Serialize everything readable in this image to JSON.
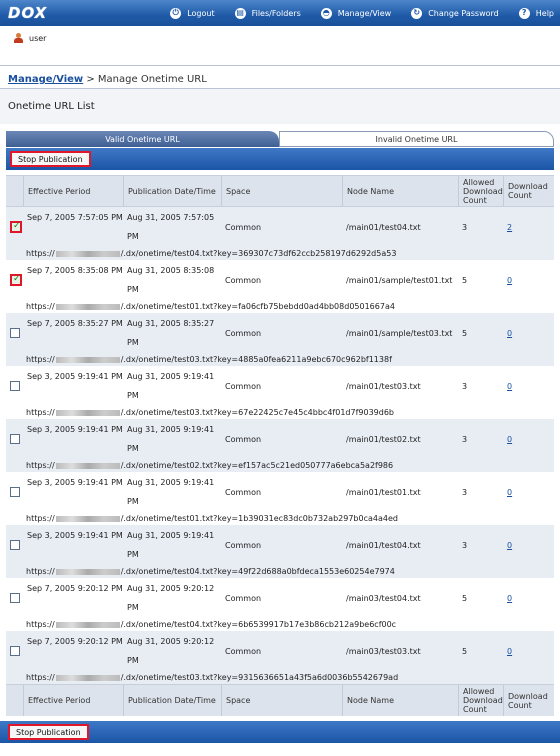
{
  "app": {
    "logo": "DOX",
    "nav": [
      {
        "icon": "logout-icon",
        "label": "Logout"
      },
      {
        "icon": "folder-icon",
        "label": "Files/Folders"
      },
      {
        "icon": "manage-icon",
        "label": "Manage/View"
      },
      {
        "icon": "refresh-icon",
        "label": "Change Password"
      },
      {
        "icon": "help-icon",
        "label": "Help"
      }
    ],
    "user": "user"
  },
  "breadcrumb": {
    "link": "Manage/View",
    "separator": " > ",
    "current": "Manage Onetime URL"
  },
  "section_title": "Onetime URL List",
  "tabs": [
    {
      "label": "Valid Onetime URL",
      "active": true
    },
    {
      "label": "Invalid Onetime URL",
      "active": false
    }
  ],
  "actions": {
    "stop_label": "Stop Publication"
  },
  "table": {
    "headers": {
      "effective": "Effective Period",
      "publication": "Publication Date/Time",
      "space": "Space",
      "node": "Node Name",
      "allowed": "Allowed Download Count",
      "download": "Download Count"
    },
    "rows": [
      {
        "checked": true,
        "effective": "Sep 7, 2005 7:57:05 PM",
        "publication": "Aug 31, 2005 7:57:05 PM",
        "space": "Common",
        "node": "/main01/test04.txt",
        "allowed": "3",
        "download": "2",
        "url_prefix": "https://",
        "url_suffix": "/.dx/onetime/test04.txt?key=369307c73df62ccb258197d6292d5a53"
      },
      {
        "checked": true,
        "effective": "Sep 7, 2005 8:35:08 PM",
        "publication": "Aug 31, 2005 8:35:08 PM",
        "space": "Common",
        "node": "/main01/sample/test01.txt",
        "allowed": "5",
        "download": "0",
        "url_prefix": "https://",
        "url_suffix": "/.dx/onetime/test01.txt?key=fa06cfb75bebdd0ad4bb08d0501667a4"
      },
      {
        "checked": false,
        "effective": "Sep 7, 2005 8:35:27 PM",
        "publication": "Aug 31, 2005 8:35:27 PM",
        "space": "Common",
        "node": "/main01/sample/test03.txt",
        "allowed": "5",
        "download": "0",
        "url_prefix": "https://",
        "url_suffix": "/.dx/onetime/test03.txt?key=4885a0fea6211a9ebc670c962bf1138f"
      },
      {
        "checked": false,
        "effective": "Sep 3, 2005 9:19:41 PM",
        "publication": "Aug 31, 2005 9:19:41 PM",
        "space": "Common",
        "node": "/main01/test03.txt",
        "allowed": "3",
        "download": "0",
        "url_prefix": "https://",
        "url_suffix": "/.dx/onetime/test03.txt?key=67e22425c7e45c4bbc4f01d7f9039d6b"
      },
      {
        "checked": false,
        "effective": "Sep 3, 2005 9:19:41 PM",
        "publication": "Aug 31, 2005 9:19:41 PM",
        "space": "Common",
        "node": "/main01/test02.txt",
        "allowed": "3",
        "download": "0",
        "url_prefix": "https://",
        "url_suffix": "/.dx/onetime/test02.txt?key=ef157ac5c21ed050777a6ebca5a2f986"
      },
      {
        "checked": false,
        "effective": "Sep 3, 2005 9:19:41 PM",
        "publication": "Aug 31, 2005 9:19:41 PM",
        "space": "Common",
        "node": "/main01/test01.txt",
        "allowed": "3",
        "download": "0",
        "url_prefix": "https://",
        "url_suffix": "/.dx/onetime/test01.txt?key=1b39031ec83dc0b732ab297b0ca4a4ed"
      },
      {
        "checked": false,
        "effective": "Sep 3, 2005 9:19:41 PM",
        "publication": "Aug 31, 2005 9:19:41 PM",
        "space": "Common",
        "node": "/main01/test04.txt",
        "allowed": "3",
        "download": "0",
        "url_prefix": "https://",
        "url_suffix": "/.dx/onetime/test04.txt?key=49f22d688a0bfdeca1553e60254e7974"
      },
      {
        "checked": false,
        "effective": "Sep 7, 2005 9:20:12 PM",
        "publication": "Aug 31, 2005 9:20:12 PM",
        "space": "Common",
        "node": "/main03/test04.txt",
        "allowed": "5",
        "download": "0",
        "url_prefix": "https://",
        "url_suffix": "/.dx/onetime/test04.txt?key=6b6539917b17e3b86cb212a9be6cf00c"
      },
      {
        "checked": false,
        "effective": "Sep 7, 2005 9:20:12 PM",
        "publication": "Aug 31, 2005 9:20:12 PM",
        "space": "Common",
        "node": "/main03/test03.txt",
        "allowed": "5",
        "download": "0",
        "url_prefix": "https://",
        "url_suffix": "/.dx/onetime/test03.txt?key=9315636651a43f5a6d0036b5542679ad"
      }
    ]
  }
}
